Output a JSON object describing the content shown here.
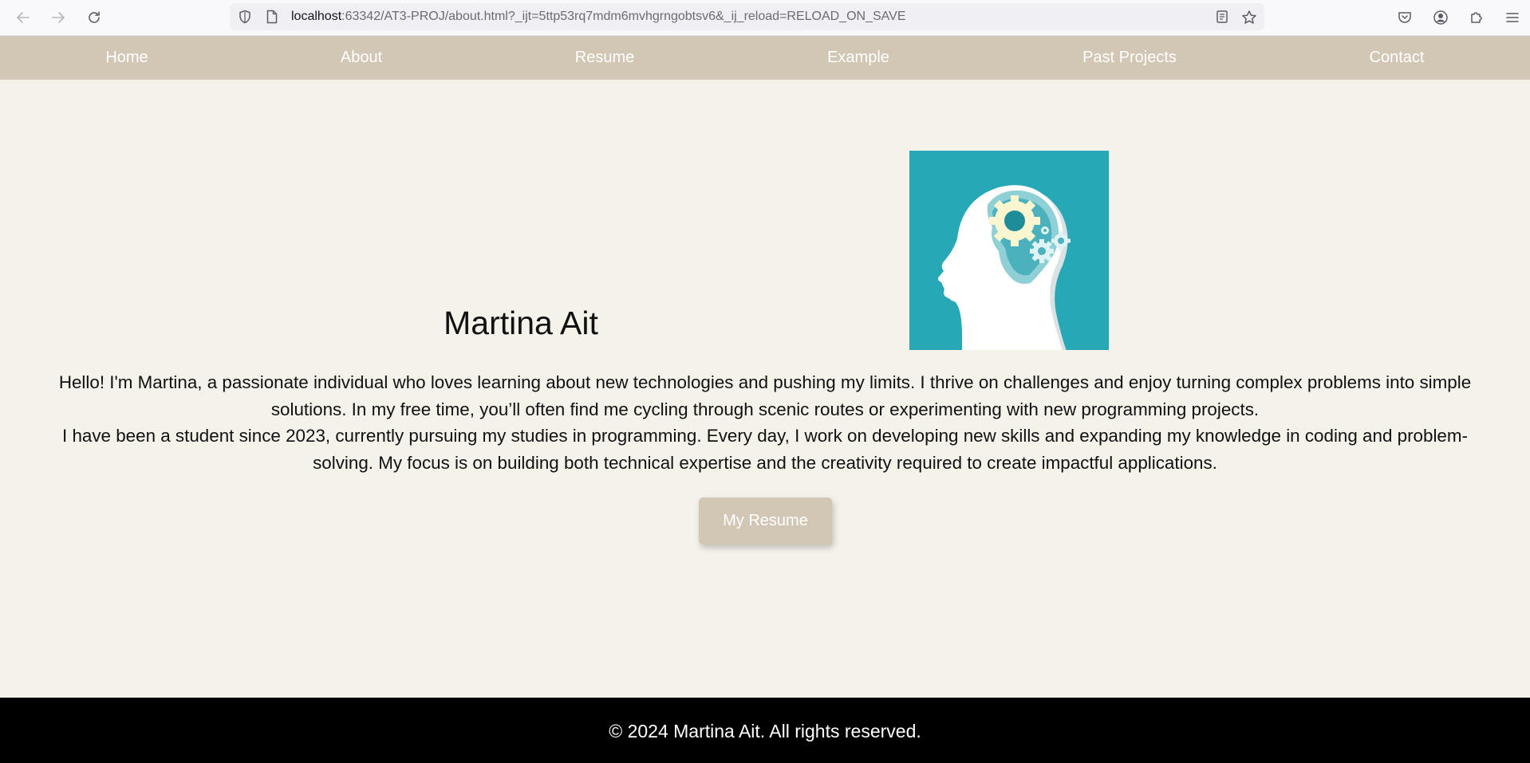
{
  "browser": {
    "url_host": "localhost",
    "url_rest": ":63342/AT3-PROJ/about.html?_ijt=5ttp53rq7mdm6mvhgrngobtsv6&_ij_reload=RELOAD_ON_SAVE",
    "icons": [
      "back-arrow-icon",
      "forward-arrow-icon",
      "reload-icon",
      "shield-icon",
      "page-icon",
      "reader-view-icon",
      "bookmark-star-icon",
      "pocket-icon",
      "account-icon",
      "extensions-icon",
      "menu-icon"
    ]
  },
  "nav": {
    "items": [
      "Home",
      "About",
      "Resume",
      "Example",
      "Past Projects",
      "Contact"
    ]
  },
  "profile": {
    "name": "Martina Ait",
    "image": "brain-gears-icon",
    "image_bg": "#26a8b6"
  },
  "bio": {
    "paragraph1": "Hello! I'm Martina, a passionate individual who loves learning about new technologies and pushing my limits. I thrive on challenges and enjoy turning complex problems into simple solutions. In my free time, you’ll often find me cycling through scenic routes or experimenting with new programming projects.",
    "paragraph2": "I have been a student since 2023, currently pursuing my studies in programming. Every day, I work on developing new skills and expanding my knowledge in coding and problem-solving. My focus is on building both technical expertise and the creativity required to create impactful applications."
  },
  "cta": {
    "label": "My Resume"
  },
  "footer": {
    "text": "© 2024 Martina Ait. All rights reserved."
  },
  "colors": {
    "page_bg": "#f5f2ea",
    "nav_bg": "#d1c7b4",
    "button_bg": "#d1c7b4",
    "footer_bg": "#000000"
  }
}
